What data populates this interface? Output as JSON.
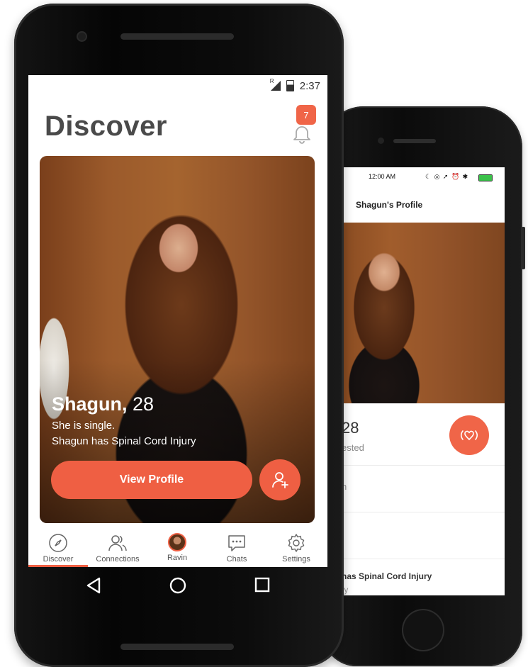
{
  "android": {
    "status": {
      "signal_label": "R",
      "time": "2:37"
    },
    "title": "Discover",
    "notifications": {
      "count": "7"
    },
    "card": {
      "name": "Shagun,",
      "age": "28",
      "line1": "She is single.",
      "line2": "Shagun has Spinal Cord Injury",
      "view_profile_label": "View Profile"
    },
    "tabs": [
      {
        "label": "Discover",
        "icon": "compass-icon",
        "active": true
      },
      {
        "label": "Connections",
        "icon": "people-icon"
      },
      {
        "label": "Ravin",
        "icon": "avatar"
      },
      {
        "label": "Chats",
        "icon": "chat-icon"
      },
      {
        "label": "Settings",
        "icon": "gear-icon"
      }
    ],
    "accent": "#ef5f43"
  },
  "iphone": {
    "status": {
      "time": "12:00 AM"
    },
    "title": "Shagun's Profile",
    "age_fragment": "28",
    "sub_fragment": "ested",
    "row1_fragment": "n",
    "row3_title_fragment": "has Spinal Cord Injury",
    "row3_sub_fragment": "ty"
  }
}
